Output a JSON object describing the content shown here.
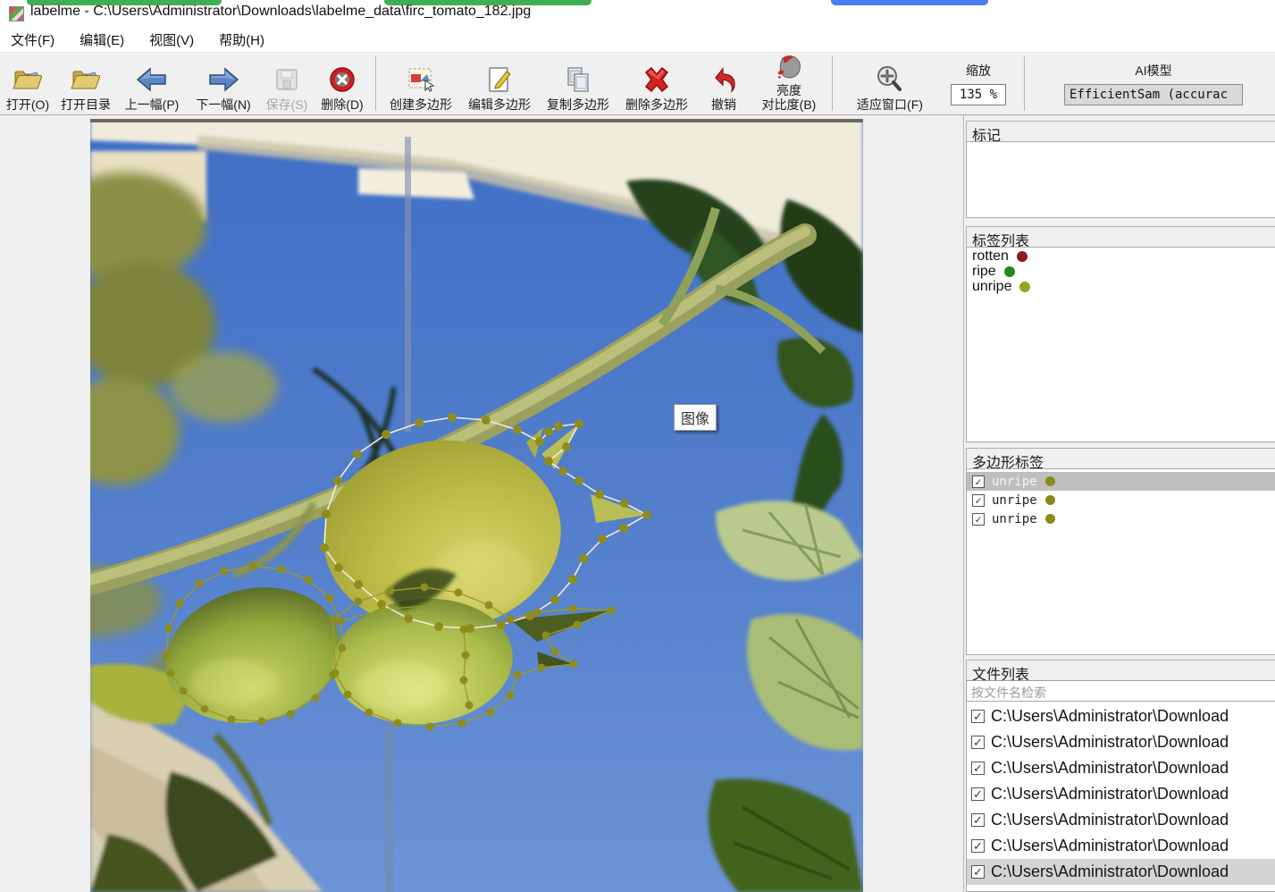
{
  "window": {
    "title": "labelme - C:\\Users\\Administrator\\Downloads\\labelme_data\\firc_tomato_182.jpg"
  },
  "menu": {
    "items": [
      {
        "label": "文件(F)"
      },
      {
        "label": "编辑(E)"
      },
      {
        "label": "视图(V)"
      },
      {
        "label": "帮助(H)"
      }
    ]
  },
  "toolbar": {
    "buttons": [
      {
        "label": "打开(O)",
        "icon": "open-folder-icon",
        "enabled": true
      },
      {
        "label": "打开目录",
        "icon": "open-dir-icon",
        "enabled": true
      },
      {
        "label": "上一幅(P)",
        "icon": "prev-arrow-icon",
        "enabled": true
      },
      {
        "label": "下一幅(N)",
        "icon": "next-arrow-icon",
        "enabled": true
      },
      {
        "label": "保存(S)",
        "icon": "save-icon",
        "enabled": false
      },
      {
        "label": "删除(D)",
        "icon": "delete-icon",
        "enabled": true
      },
      {
        "label": "创建多边形",
        "icon": "create-polygon-icon",
        "enabled": true
      },
      {
        "label": "编辑多边形",
        "icon": "edit-polygon-icon",
        "enabled": true
      },
      {
        "label": "复制多边形",
        "icon": "duplicate-polygon-icon",
        "enabled": true
      },
      {
        "label": "删除多边形",
        "icon": "delete-polygon-icon",
        "enabled": true
      },
      {
        "label": "撤销",
        "icon": "undo-icon",
        "enabled": true
      },
      {
        "label_line1": "亮度",
        "label_line2": "对比度(B)",
        "icon": "brightness-contrast-icon",
        "enabled": true
      },
      {
        "label": "适应窗口(F)",
        "icon": "fit-window-icon",
        "enabled": true
      }
    ],
    "zoom": {
      "label": "缩放",
      "value": "135 %"
    },
    "ai_model": {
      "label": "AI模型",
      "value": "EfficientSam (accurac"
    }
  },
  "canvas": {
    "tooltip": "图像"
  },
  "sidebar": {
    "flags": {
      "title": "标记"
    },
    "label_list": {
      "title": "标签列表",
      "items": [
        {
          "name": "rotten",
          "color": "#8b1a1a"
        },
        {
          "name": "ripe",
          "color": "#1f8b1f"
        },
        {
          "name": "unripe",
          "color": "#9aa020"
        }
      ]
    },
    "polygon_labels": {
      "title": "多边形标签",
      "items": [
        {
          "label": "unripe",
          "checked": "✓",
          "color": "#8a8a1a",
          "selected": true
        },
        {
          "label": "unripe",
          "checked": "✓",
          "color": "#8a8a1a",
          "selected": false
        },
        {
          "label": "unripe",
          "checked": "✓",
          "color": "#8a8a1a",
          "selected": false
        }
      ]
    },
    "file_list": {
      "title": "文件列表",
      "search_placeholder": "按文件名检索",
      "items": [
        {
          "path": "C:\\Users\\Administrator\\Download",
          "checked": "✓"
        },
        {
          "path": "C:\\Users\\Administrator\\Download",
          "checked": "✓"
        },
        {
          "path": "C:\\Users\\Administrator\\Download",
          "checked": "✓"
        },
        {
          "path": "C:\\Users\\Administrator\\Download",
          "checked": "✓"
        },
        {
          "path": "C:\\Users\\Administrator\\Download",
          "checked": "✓"
        },
        {
          "path": "C:\\Users\\Administrator\\Download",
          "checked": "✓"
        },
        {
          "path": "C:\\Users\\Administrator\\Download",
          "checked": "✓"
        }
      ]
    }
  }
}
